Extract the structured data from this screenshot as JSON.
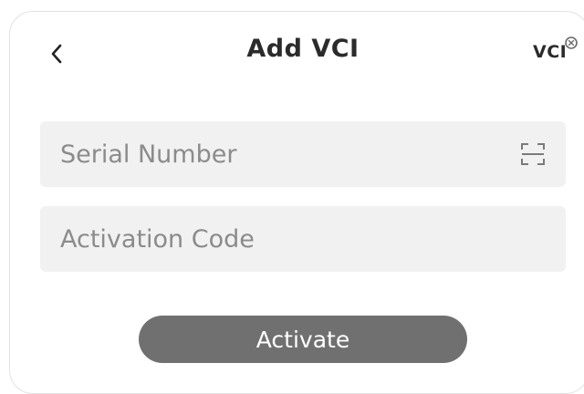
{
  "header": {
    "title": "Add VCI",
    "vci_label": "VCI"
  },
  "form": {
    "serial_placeholder": "Serial Number",
    "serial_value": "",
    "code_placeholder": "Activation Code",
    "code_value": ""
  },
  "actions": {
    "activate_label": "Activate"
  },
  "icons": {
    "back": "chevron-left-icon",
    "vci": "vci-device-icon",
    "scan": "scan-icon"
  },
  "colors": {
    "button": "#707070",
    "field_bg": "#f1f1f1",
    "text": "#2b2b2b",
    "placeholder": "#8b8b8b"
  }
}
